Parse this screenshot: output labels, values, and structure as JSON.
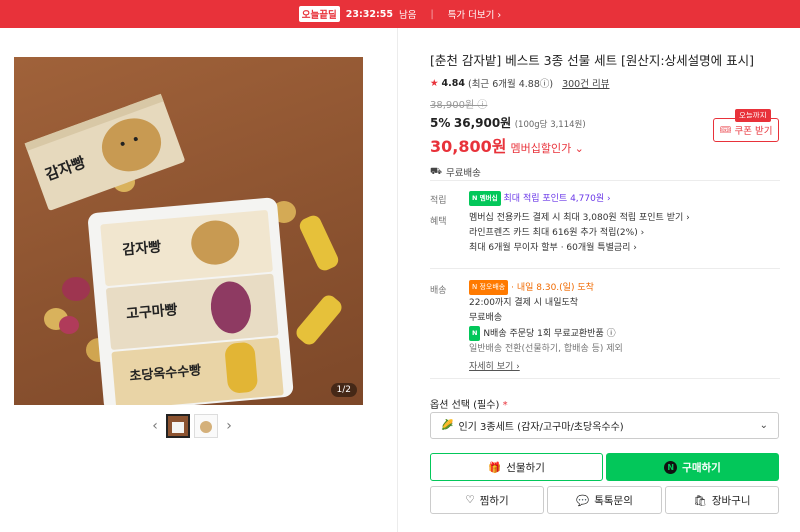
{
  "topbar": {
    "deal_label": "오늘끝딜",
    "timer": "23:32:55",
    "timer_suffix": "남음",
    "more_label": "특가 더보기 ›"
  },
  "gallery": {
    "pager": "1/2",
    "box_labels": [
      "감자빵",
      "고구마빵",
      "초당옥수수빵"
    ],
    "top_box_label": "감자빵"
  },
  "product": {
    "title": "[춘천 감자밭] 베스트 3종 선물 세트 [원산지:상세설명에 표시]",
    "rating": "4.84",
    "rating_recent": "(최근 6개월 4.88ⓘ)",
    "review_count": "300건 리뷰",
    "original_price": "38,900원 ⓘ",
    "discount_rate": "5%",
    "price": "36,900원",
    "unit_price": "(100g당 3,114원)",
    "member_price": "30,800원",
    "member_label": "멤버십할인가 ⌄",
    "free_shipping": "무료배송",
    "coupon_tag": "오늘까지",
    "coupon_label": "쿠폰 받기"
  },
  "points": {
    "label": "적립",
    "npay_badge": "N 멤버십",
    "max_points": "최대 적립 포인트 4,770원 ›"
  },
  "benefits": {
    "label": "혜택",
    "lines": [
      "멤버십 전용카드 결제 시 최대 3,080원 적립 포인트 받기 ›",
      "라인프렌즈 카드 최대 616원 추가 적립(2%) ›",
      "최대 6개월 무이자 할부 · 60개월 특별금리 ›"
    ]
  },
  "delivery": {
    "label": "배송",
    "today_badge": "N 정오배송",
    "arrival": "· 내일 8.30.(일) 도착",
    "cutoff": "22:00까지 결제 시 내일도착",
    "free": "무료배송",
    "return_note": "N배송 주문당 1회 무료교환반품 ⓘ",
    "exclude_note": "일반배송 전환(선물하기, 합배송 등) 제외",
    "more": "자세히 보기 ›"
  },
  "option": {
    "label": "옵션 선택 (필수)",
    "required_mark": "*",
    "selected": "인기 3종세트 (감자/고구마/초당옥수수)"
  },
  "buttons": {
    "gift": "선물하기",
    "buy": "구매하기",
    "like": "찜하기",
    "talk": "톡톡문의",
    "cart": "장바구니"
  },
  "colors": {
    "brand_red": "#e8323a",
    "naver_green": "#03c75a",
    "purple": "#6a38e8"
  }
}
